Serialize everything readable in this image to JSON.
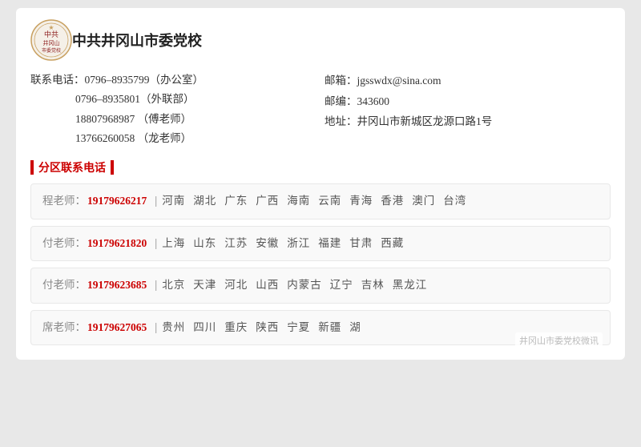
{
  "header": {
    "school_name": "中共井冈山市委党校"
  },
  "contact": {
    "phone_label": "联系电话：",
    "phones": [
      {
        "number": "0796–8935799",
        "note": "（办公室）"
      },
      {
        "number": "0796–8935801",
        "note": "（外联部）"
      },
      {
        "number": "18807968987",
        "note": "（傅老师）"
      },
      {
        "number": "13766260058",
        "note": "（龙老师）"
      }
    ],
    "email_label": "邮箱：",
    "email": "jgsswdx@sina.com",
    "zip_label": "邮编：",
    "zip": "343600",
    "address_label": "地址：",
    "address": "井冈山市新城区龙源口路1号"
  },
  "section_title": "分区联系电话",
  "regions": [
    {
      "teacher": "程老师：",
      "phone": "19179626217",
      "areas": [
        "河南",
        "湖北",
        "广东",
        "广西",
        "海南",
        "云南",
        "青海",
        "香港",
        "澳门",
        "台湾"
      ]
    },
    {
      "teacher": "付老师：",
      "phone": "19179621820",
      "areas": [
        "上海",
        "山东",
        "江苏",
        "安徽",
        "浙江",
        "福建",
        "甘肃",
        "西藏"
      ]
    },
    {
      "teacher": "付老师：",
      "phone": "19179623685",
      "areas": [
        "北京",
        "天津",
        "河北",
        "山西",
        "内蒙古",
        "辽宁",
        "吉林",
        "黑龙江"
      ]
    },
    {
      "teacher": "席老师：",
      "phone": "19179627065",
      "areas": [
        "贵州",
        "四川",
        "重庆",
        "陕西",
        "宁夏",
        "新疆",
        "湖"
      ]
    }
  ],
  "watermark": "井冈山市委党校微讯"
}
